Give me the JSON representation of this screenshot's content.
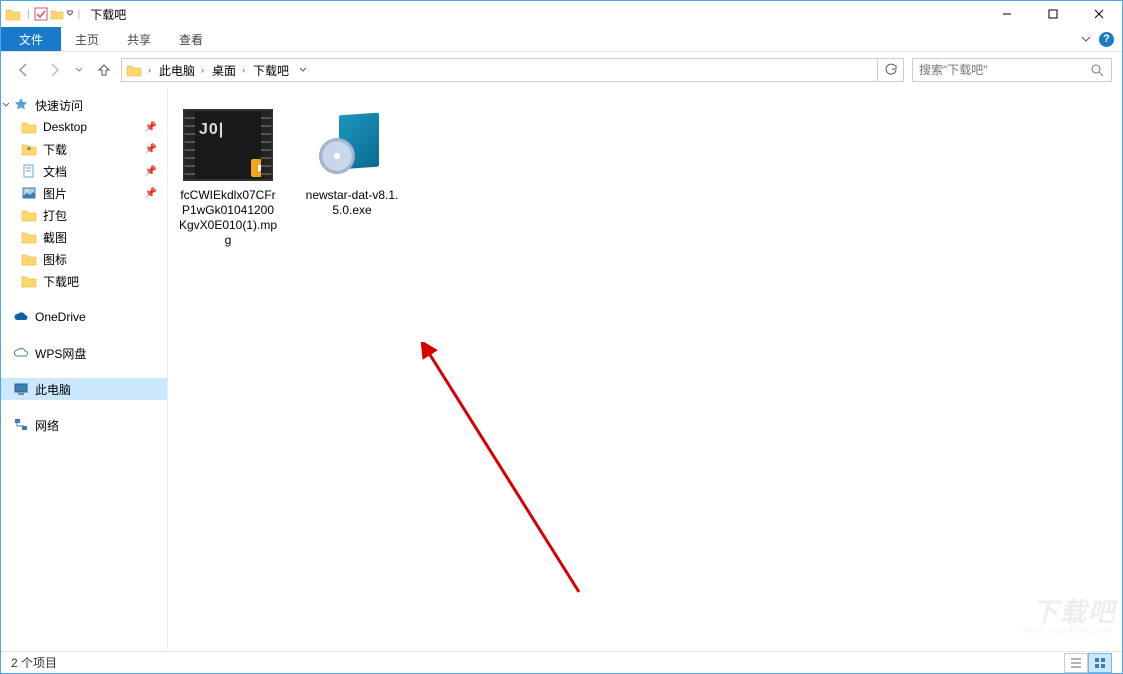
{
  "window": {
    "title": "下载吧",
    "min": "—",
    "max": "☐",
    "close": "✕"
  },
  "ribbon": {
    "file": "文件",
    "home": "主页",
    "share": "共享",
    "view": "查看"
  },
  "nav": {
    "back_tip": "返回",
    "forward_tip": "前进",
    "up_tip": "上移"
  },
  "address": {
    "seg1": "此电脑",
    "seg2": "桌面",
    "seg3": "下载吧"
  },
  "search": {
    "placeholder": "搜索\"下载吧\""
  },
  "sidebar": {
    "quick": "快速访问",
    "desktop": "Desktop",
    "downloads": "下载",
    "documents": "文档",
    "pictures": "图片",
    "dabao": "打包",
    "jietu": "截图",
    "tubiao": "图标",
    "xiazaiba": "下载吧",
    "onedrive": "OneDrive",
    "wps": "WPS网盘",
    "thispc": "此电脑",
    "network": "网络"
  },
  "files": [
    {
      "name": "fcCWIEkdlx07CFrP1wGk01041200KgvX0E010(1).mpg",
      "type": "video"
    },
    {
      "name": "newstar-dat-v8.1.5.0.exe",
      "type": "exe"
    }
  ],
  "status": {
    "count_label": "2 个项目"
  },
  "watermark": {
    "big": "下载吧",
    "url": "www.xiazaiba.com"
  }
}
